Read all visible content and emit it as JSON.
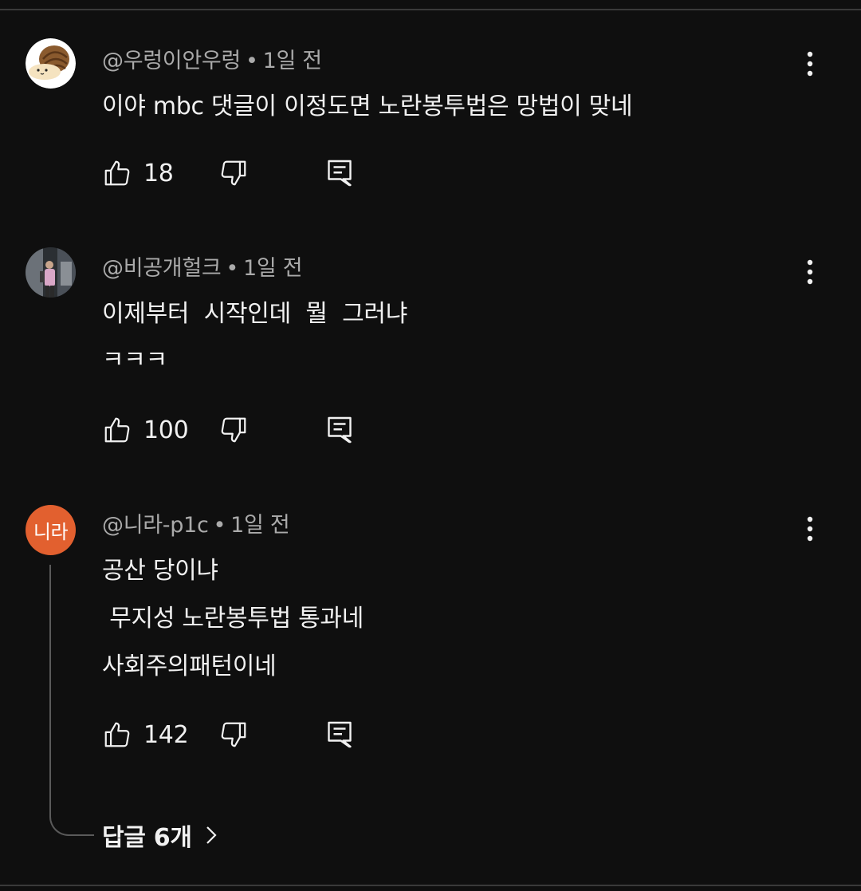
{
  "comments": [
    {
      "author": "@우렁이안우렁",
      "time": "1일 전",
      "lines": [
        "이야 mbc 댓글이 이정도면 노란봉투법은 망법이 맞네"
      ],
      "likes": "18"
    },
    {
      "author": "@비공개헐크",
      "time": "1일 전",
      "lines": [
        "이제부터  시작인데  뭘  그러냐",
        "ㅋㅋㅋ"
      ],
      "likes": "100"
    },
    {
      "author": "@니라-p1c",
      "avatar_text": "니라",
      "time": "1일 전",
      "lines": [
        "공산 당이냐",
        " 무지성 노란봉투법 통과네",
        "사회주의패턴이네"
      ],
      "likes": "142",
      "replies_label": "답글 6개"
    }
  ],
  "meta_separator": "•",
  "colors": {
    "background": "#0f0f0f",
    "primary_text": "#f1f1f1",
    "secondary_text": "#aaaaaa",
    "nara_avatar": "#e2602f"
  },
  "icons": [
    "like-icon",
    "dislike-icon",
    "reply-icon",
    "more-options-icon",
    "chevron-right-icon"
  ]
}
